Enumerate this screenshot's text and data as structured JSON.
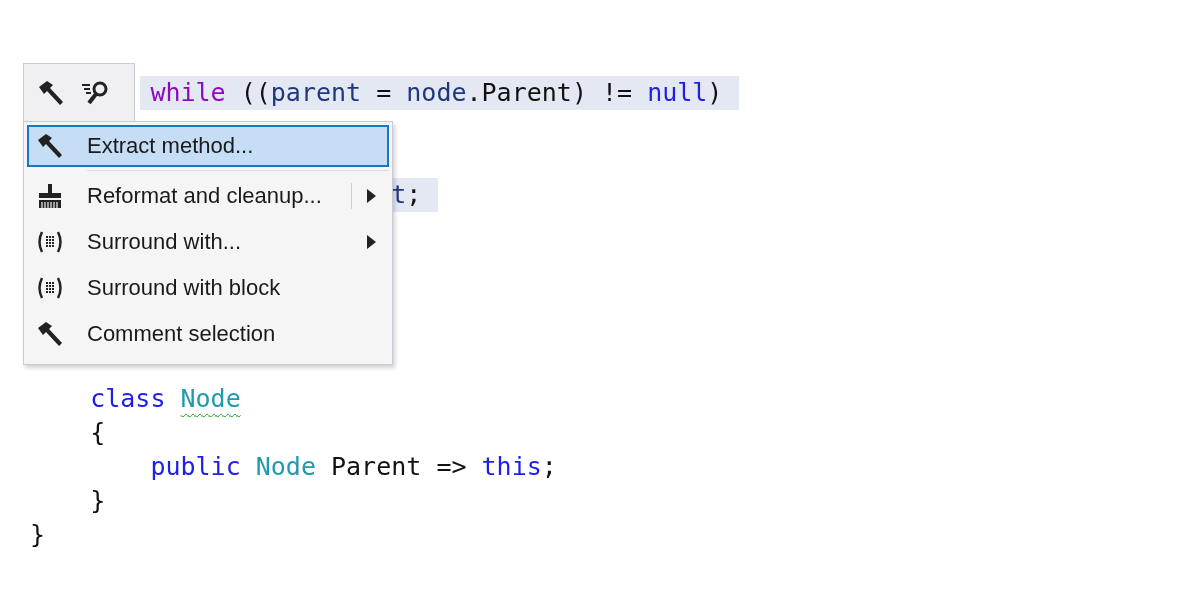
{
  "code_lines": [
    {
      "selected": true,
      "tokens": [
        {
          "kind": "control",
          "text": "while"
        },
        {
          "kind": "plain",
          "text": " (("
        },
        {
          "kind": "local",
          "text": "parent"
        },
        {
          "kind": "plain",
          "text": " = "
        },
        {
          "kind": "local",
          "text": "node"
        },
        {
          "kind": "plain",
          "text": "."
        },
        {
          "kind": "member",
          "text": "Parent"
        },
        {
          "kind": "plain",
          "text": ") != "
        },
        {
          "kind": "keyword",
          "text": "null"
        },
        {
          "kind": "plain",
          "text": ")"
        }
      ]
    },
    {
      "selected": true,
      "tokens": [
        {
          "kind": "local",
          "text": "t"
        },
        {
          "kind": "plain",
          "text": ";"
        }
      ]
    },
    {
      "selected": false,
      "tokens": [
        {
          "kind": "keyword",
          "text": "class "
        },
        {
          "kind": "type",
          "text": "Node",
          "warning": true
        }
      ]
    },
    {
      "selected": false,
      "tokens": [
        {
          "kind": "plain",
          "text": "{"
        }
      ]
    },
    {
      "selected": false,
      "tokens": [
        {
          "kind": "keyword",
          "text": "public "
        },
        {
          "kind": "type",
          "text": "Node",
          "warning": false
        },
        {
          "kind": "plain",
          "text": " Parent => "
        },
        {
          "kind": "keyword",
          "text": "this"
        },
        {
          "kind": "plain",
          "text": ";"
        }
      ]
    },
    {
      "selected": false,
      "tokens": [
        {
          "kind": "plain",
          "text": "}"
        }
      ]
    },
    {
      "selected": false,
      "tokens": [
        {
          "kind": "plain",
          "text": "}"
        }
      ]
    }
  ],
  "menu": {
    "items": [
      {
        "label": "Extract method...",
        "selected": true,
        "submenu": false,
        "split": false
      },
      {
        "label": "Reformat and cleanup...",
        "selected": false,
        "submenu": true,
        "split": true
      },
      {
        "label": "Surround with...",
        "selected": false,
        "submenu": true,
        "split": false
      },
      {
        "label": "Surround with block",
        "selected": false,
        "submenu": false,
        "split": false
      },
      {
        "label": "Comment selection",
        "selected": false,
        "submenu": false,
        "split": false
      }
    ]
  }
}
